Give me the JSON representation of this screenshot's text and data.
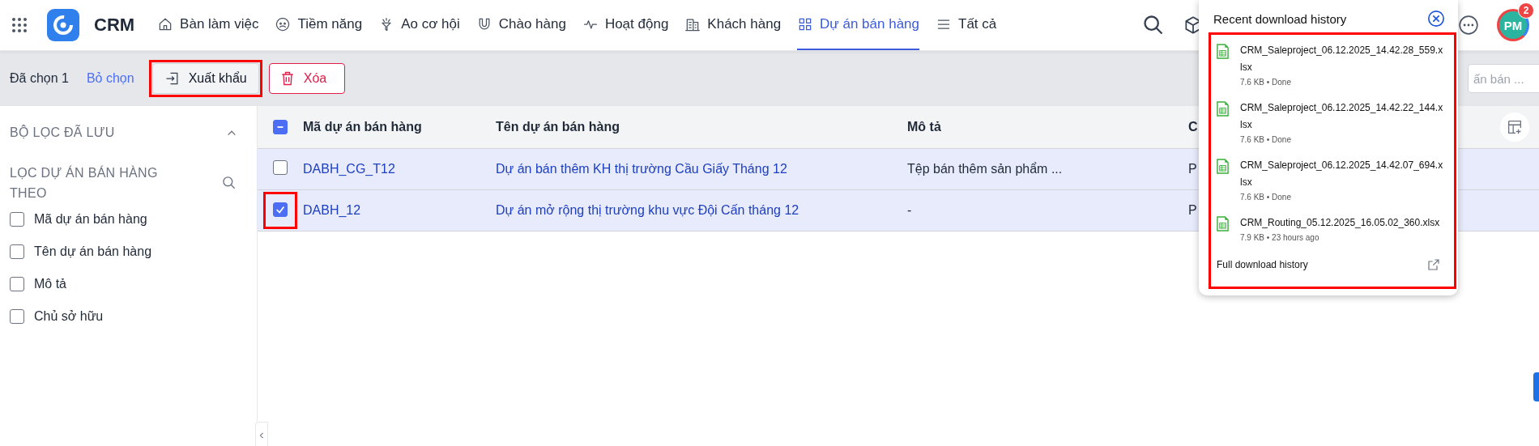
{
  "nav": {
    "app_name": "CRM",
    "items": [
      {
        "label": "Bàn làm việc",
        "selected": false
      },
      {
        "label": "Tiềm năng",
        "selected": false
      },
      {
        "label": "Ao cơ hội",
        "selected": false
      },
      {
        "label": "Chào hàng",
        "selected": false
      },
      {
        "label": "Hoạt động",
        "selected": false
      },
      {
        "label": "Khách hàng",
        "selected": false
      },
      {
        "label": "Dự án bán hàng",
        "selected": true
      },
      {
        "label": "Tất cả",
        "selected": false
      }
    ],
    "avatar_initials": "PM",
    "notification_count": "2"
  },
  "toolbar": {
    "selected_count": "Đã chọn 1",
    "deselect_link": "Bỏ chọn",
    "buttons": [
      {
        "label": "Xuất khẩu",
        "kind": "export"
      },
      {
        "label": "Xóa",
        "kind": "delete"
      }
    ],
    "search": {
      "placeholder": "ấn bán ..."
    }
  },
  "sidebar": {
    "saved_filters": {
      "title": "BỘ LỌC ĐÃ LƯU",
      "expanded": true
    },
    "filter_by": {
      "title": "LỌC DỰ ÁN BÁN HÀNG THEO",
      "fields": [
        {
          "label": "Mã dự án bán hàng",
          "checked": false
        },
        {
          "label": "Tên dự án bán hàng",
          "checked": false
        },
        {
          "label": "Mô tả",
          "checked": false
        },
        {
          "label": "Chủ sở hữu",
          "checked": false
        }
      ]
    }
  },
  "table": {
    "select_all": {
      "indeterminate": true
    },
    "columns": [
      "Mã dự án bán hàng",
      "Tên dự án bán hàng",
      "Mô tả",
      "C"
    ],
    "rows": [
      {
        "selected": false,
        "cells": [
          "DABH_CG_T12",
          "Dự án bán thêm KH thị trường Cầu Giấy Tháng 12",
          "Tệp bán thêm sản phẩm ...",
          "P"
        ]
      },
      {
        "selected": true,
        "cells": [
          "DABH_12",
          "Dự án mở rộng thị trường khu vực Đội Cấn tháng 12",
          "-",
          "P"
        ]
      }
    ]
  },
  "download_history": {
    "title": "Recent download history",
    "items": [
      {
        "filename": "CRM_Saleproject_06.12.2025_14.42.28_559.xlsx",
        "meta": "7.6 KB • Done"
      },
      {
        "filename": "CRM_Saleproject_06.12.2025_14.42.22_144.xlsx",
        "meta": "7.6 KB • Done"
      },
      {
        "filename": "CRM_Saleproject_06.12.2025_14.42.07_694.xlsx",
        "meta": "7.6 KB • Done"
      },
      {
        "filename": "CRM_Routing_05.12.2025_16.05.02_360.xlsx",
        "meta": "7.9 KB • 23 hours ago"
      }
    ],
    "footer_link": "Full download history"
  }
}
